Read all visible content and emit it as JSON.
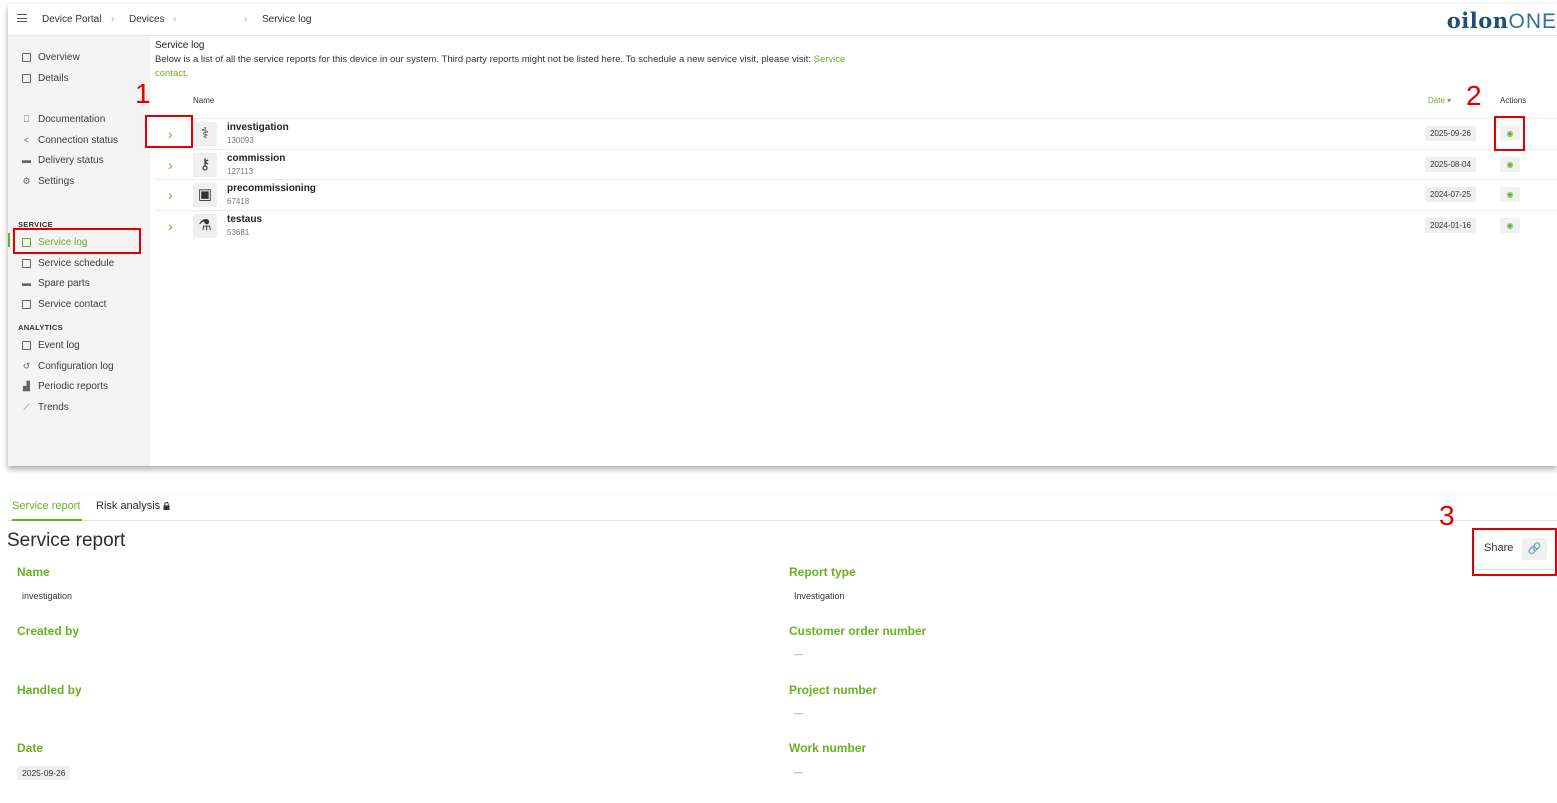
{
  "topbar": {
    "breadcrumbs": [
      "Device Portal",
      "Devices",
      "",
      "Service log"
    ],
    "logo": {
      "part1": "oilon",
      "part2": "ONE"
    }
  },
  "sidebar": {
    "items": [
      {
        "label": "Overview",
        "icon": "window-icon"
      },
      {
        "label": "Details",
        "icon": "list-icon"
      },
      {
        "label": "Documentation",
        "icon": "book-icon"
      },
      {
        "label": "Connection status",
        "icon": "share-icon"
      },
      {
        "label": "Delivery status",
        "icon": "truck-icon"
      },
      {
        "label": "Settings",
        "icon": "gears-icon"
      }
    ],
    "service_heading": "SERVICE",
    "service_items": [
      {
        "label": "Service log",
        "icon": "log-icon",
        "active": true
      },
      {
        "label": "Service schedule",
        "icon": "calendar-icon"
      },
      {
        "label": "Spare parts",
        "icon": "toolbox-icon"
      },
      {
        "label": "Service contact",
        "icon": "contact-card-icon"
      }
    ],
    "analytics_heading": "ANALYTICS",
    "analytics_items": [
      {
        "label": "Event log",
        "icon": "event-log-icon"
      },
      {
        "label": "Configuration log",
        "icon": "history-icon"
      },
      {
        "label": "Periodic reports",
        "icon": "bar-chart-icon"
      },
      {
        "label": "Trends",
        "icon": "line-chart-icon"
      }
    ]
  },
  "main": {
    "heading": "Service log",
    "description": "Below is a list of all the service reports for this device in our system. Third party reports might not be listed here. To schedule a new service visit, please visit: ",
    "description_link": "Service contact",
    "description_end": ".",
    "columns": {
      "name": "Name",
      "date": "Date",
      "actions": "Actions"
    },
    "rows": [
      {
        "name": "investigation",
        "number": "130093",
        "date": "2025-09-26",
        "icon": "stethoscope-icon"
      },
      {
        "name": "commission",
        "number": "127113",
        "date": "2025-08-04",
        "icon": "key-icon"
      },
      {
        "name": "precommissioning",
        "number": "67418",
        "date": "2024-07-25",
        "icon": "briefcase-icon"
      },
      {
        "name": "testaus",
        "number": "53681",
        "date": "2024-01-16",
        "icon": "flask-icon"
      }
    ]
  },
  "report": {
    "tabs": [
      "Service report",
      "Risk analysis"
    ],
    "title": "Service report",
    "share_label": "Share",
    "fields_left": [
      {
        "label": "Name",
        "value": "investigation"
      },
      {
        "label": "Created by",
        "value": ""
      },
      {
        "label": "Handled by",
        "value": ""
      },
      {
        "label": "Date",
        "value": "2025-09-26"
      }
    ],
    "fields_right": [
      {
        "label": "Report type",
        "value": "Investigation"
      },
      {
        "label": "Customer order number",
        "value": "—"
      },
      {
        "label": "Project number",
        "value": "—"
      },
      {
        "label": "Work number",
        "value": "—"
      }
    ]
  },
  "annotations": [
    "1",
    "2",
    "3"
  ],
  "colors": {
    "accent": "#6ab023",
    "annotation": "#e00000",
    "logo": "#1f4e79"
  }
}
